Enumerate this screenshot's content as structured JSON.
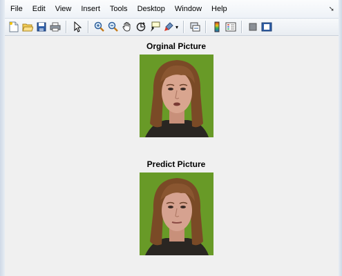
{
  "menubar": {
    "items": [
      "File",
      "Edit",
      "View",
      "Insert",
      "Tools",
      "Desktop",
      "Window",
      "Help"
    ],
    "dock_icon": "undock-arrow-icon"
  },
  "toolbar": {
    "buttons": [
      "new-figure-icon",
      "open-file-icon",
      "save-figure-icon",
      "print-figure-icon",
      "edit-plot-arrow-icon",
      "zoom-in-icon",
      "zoom-out-icon",
      "pan-hand-icon",
      "rotate-3d-icon",
      "data-cursor-icon",
      "brush-icon",
      "link-plot-icon",
      "insert-colorbar-icon",
      "insert-legend-icon",
      "hide-plot-tools-icon",
      "show-plot-tools-icon"
    ]
  },
  "figures": {
    "original_title": "Orginal Picture",
    "predict_title": "Predict Picture"
  },
  "colors": {
    "photo_background": "#6fa02a",
    "hair": "#7a4a26",
    "skin": "#d9a58f",
    "shirt": "#2a2622"
  }
}
